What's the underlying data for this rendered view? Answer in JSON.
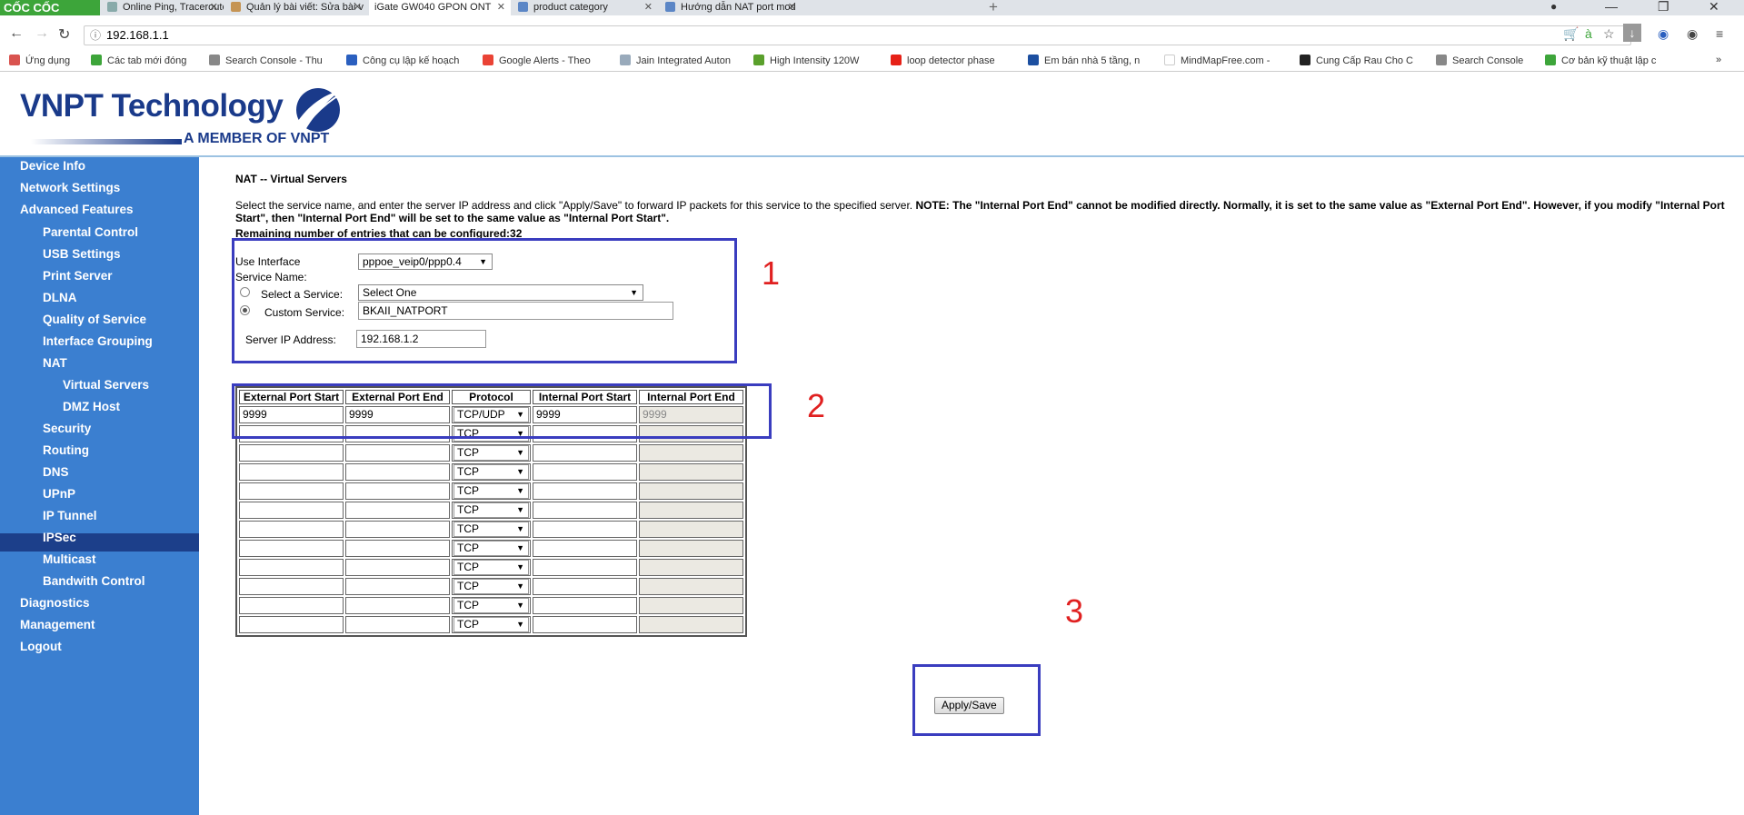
{
  "browser": {
    "logo": "CỐC CỐC",
    "tabs": [
      {
        "title": "Online Ping, Traceroute, D"
      },
      {
        "title": "Quản lý bài viết: Sửa bài v"
      },
      {
        "title": "iGate GW040 GPON ONT"
      },
      {
        "title": "product category"
      },
      {
        "title": "Hướng dẫn NAT port mod"
      }
    ],
    "url": "192.168.1.1",
    "bookmarks": [
      {
        "label": "Ứng dụng"
      },
      {
        "label": "Các tab mới đóng"
      },
      {
        "label": "Search Console - Thu"
      },
      {
        "label": "Công cụ lập kế hoạch"
      },
      {
        "label": "Google Alerts - Theo"
      },
      {
        "label": "Jain Integrated Auton"
      },
      {
        "label": "High Intensity 120W"
      },
      {
        "label": "loop detector phase"
      },
      {
        "label": "Em bán nhà 5 tầng, n"
      },
      {
        "label": "MindMapFree.com -"
      },
      {
        "label": "Cung Cấp Rau Cho C"
      },
      {
        "label": "Search Console"
      },
      {
        "label": "Cơ bản kỹ thuật lập c"
      }
    ]
  },
  "header": {
    "brand": "VNPT Technology",
    "tagline": "A MEMBER OF VNPT"
  },
  "sidebar": {
    "items": [
      {
        "label": "Device Info",
        "level": 1
      },
      {
        "label": "Network Settings",
        "level": 1
      },
      {
        "label": "Advanced Features",
        "level": 1
      },
      {
        "label": "Parental Control",
        "level": 2
      },
      {
        "label": "USB Settings",
        "level": 2
      },
      {
        "label": "Print Server",
        "level": 2
      },
      {
        "label": "DLNA",
        "level": 2
      },
      {
        "label": "Quality of Service",
        "level": 2
      },
      {
        "label": "Interface Grouping",
        "level": 2
      },
      {
        "label": "NAT",
        "level": 2
      },
      {
        "label": "Virtual Servers",
        "level": 3,
        "active": true
      },
      {
        "label": "DMZ Host",
        "level": 3
      },
      {
        "label": "Security",
        "level": 2
      },
      {
        "label": "Routing",
        "level": 2
      },
      {
        "label": "DNS",
        "level": 2
      },
      {
        "label": "UPnP",
        "level": 2
      },
      {
        "label": "IP Tunnel",
        "level": 2
      },
      {
        "label": "IPSec",
        "level": 2
      },
      {
        "label": "Multicast",
        "level": 2
      },
      {
        "label": "Bandwith Control",
        "level": 2
      },
      {
        "label": "Diagnostics",
        "level": 1
      },
      {
        "label": "Management",
        "level": 1
      },
      {
        "label": "Logout",
        "level": 1
      }
    ]
  },
  "main": {
    "title": "NAT -- Virtual Servers",
    "description": "Select the service name, and enter the server IP address and click \"Apply/Save\" to forward IP packets for this service to the specified server. ",
    "note": "NOTE: The \"Internal Port End\" cannot be modified directly. Normally, it is set to the same value as \"External Port End\". However, if you modify \"Internal Port Start\", then \"Internal Port End\" will be set to the same value as \"Internal Port Start\".",
    "remaining": "Remaining number of entries that can be configured:32",
    "use_interface_label": "Use Interface",
    "use_interface_value": "pppoe_veip0/ppp0.4",
    "service_name_label": "Service Name:",
    "select_service_label": "Select a Service:",
    "select_service_value": "Select One",
    "custom_service_label": "Custom Service:",
    "custom_service_value": "BKAII_NATPORT",
    "server_ip_label": "Server IP Address:",
    "server_ip_value": "192.168.1.2",
    "table": {
      "headers": [
        "External Port Start",
        "External Port End",
        "Protocol",
        "Internal Port Start",
        "Internal Port End"
      ],
      "rows": [
        [
          "9999",
          "9999",
          "TCP/UDP",
          "9999",
          "9999"
        ],
        [
          "",
          "",
          "TCP",
          "",
          ""
        ],
        [
          "",
          "",
          "TCP",
          "",
          ""
        ],
        [
          "",
          "",
          "TCP",
          "",
          ""
        ],
        [
          "",
          "",
          "TCP",
          "",
          ""
        ],
        [
          "",
          "",
          "TCP",
          "",
          ""
        ],
        [
          "",
          "",
          "TCP",
          "",
          ""
        ],
        [
          "",
          "",
          "TCP",
          "",
          ""
        ],
        [
          "",
          "",
          "TCP",
          "",
          ""
        ],
        [
          "",
          "",
          "TCP",
          "",
          ""
        ],
        [
          "",
          "",
          "TCP",
          "",
          ""
        ],
        [
          "",
          "",
          "TCP",
          "",
          ""
        ]
      ]
    },
    "apply_label": "Apply/Save"
  },
  "annotations": [
    "1",
    "2",
    "3"
  ],
  "colors": {
    "sidebar_bg": "#3b7fd0",
    "sidebar_active": "#1c3f8a",
    "brand": "#1a3a8a",
    "annotation_box": "#3a3dbf",
    "annotation_number": "#e02020"
  }
}
